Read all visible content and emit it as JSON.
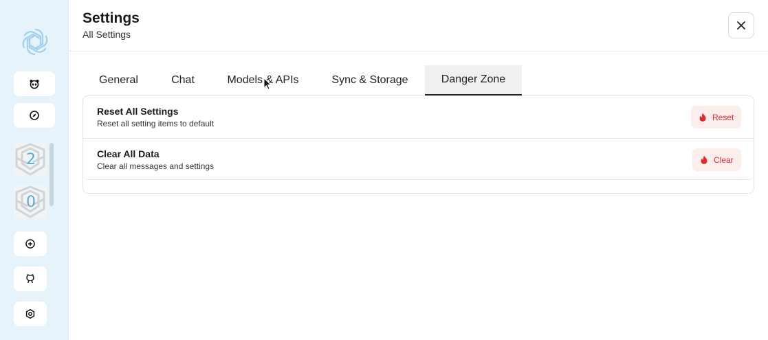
{
  "sidebar": {
    "logo": "openai-logo-icon",
    "buttons": [
      {
        "icon": "panda-icon"
      },
      {
        "icon": "compass-icon"
      }
    ],
    "sessions": [
      {
        "count": "2"
      },
      {
        "count": "0"
      }
    ],
    "bottom_buttons": [
      {
        "icon": "add-circle-icon"
      },
      {
        "icon": "github-icon"
      },
      {
        "icon": "settings-icon"
      }
    ]
  },
  "header": {
    "title": "Settings",
    "subtitle": "All Settings",
    "close_icon": "close-icon"
  },
  "tabs": [
    {
      "label": "General",
      "active": false
    },
    {
      "label": "Chat",
      "active": false
    },
    {
      "label": "Models & APIs",
      "active": false
    },
    {
      "label": "Sync & Storage",
      "active": false
    },
    {
      "label": "Danger Zone",
      "active": true
    }
  ],
  "danger": {
    "items": [
      {
        "title": "Reset All Settings",
        "description": "Reset all setting items to default",
        "button_label": "Reset",
        "button_icon": "fire-icon"
      },
      {
        "title": "Clear All Data",
        "description": "Clear all messages and settings",
        "button_label": "Clear",
        "button_icon": "fire-icon"
      }
    ]
  },
  "colors": {
    "sidebar_bg": "#e6f3fa",
    "danger_text": "#e0282e",
    "danger_bg": "#fdeeee",
    "accent_number": "#5aa9d6"
  }
}
